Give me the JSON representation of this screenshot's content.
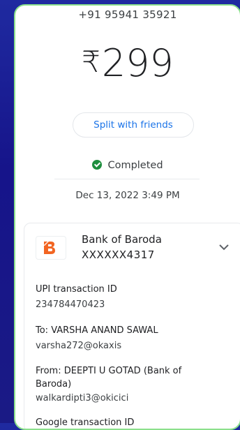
{
  "transaction": {
    "phone": "+91 95941 35921",
    "currency_symbol": "₹",
    "amount": "299",
    "split_label": "Split with friends",
    "status": "Completed",
    "datetime": "Dec 13, 2022 3:49 PM"
  },
  "bank": {
    "name": "Bank of Baroda",
    "account": "XXXXXX4317"
  },
  "details": {
    "upi_label": "UPI transaction ID",
    "upi_id": "234784470423",
    "to_label": "To: VARSHA ANAND SAWAL",
    "to_upi": "varsha272@okaxis",
    "from_label": "From: DEEPTI U GOTAD (Bank of Baroda)",
    "from_upi": "walkardipti3@okicici",
    "google_label": "Google transaction ID"
  },
  "colors": {
    "accent": "#1a73e8",
    "success": "#1e8e3e",
    "bank_orange": "#f26522"
  }
}
